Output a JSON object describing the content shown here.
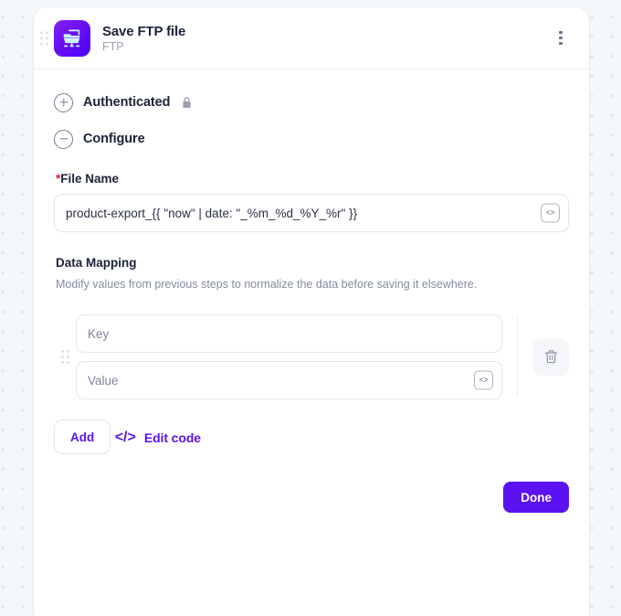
{
  "card": {
    "title": "Save FTP file",
    "subtitle": "FTP",
    "app_icon": "ftp-folder-icon",
    "drag_handle_icon": "drag-handle-icon",
    "menu_icon": "kebab-menu-icon",
    "icon_gradient_from": "#8322f5",
    "icon_gradient_to": "#4b04ff"
  },
  "sections": {
    "authenticated": {
      "label": "Authenticated",
      "toggle_icon": "plus-circle-icon",
      "lock_icon": "lock-icon",
      "expanded": false
    },
    "configure": {
      "label": "Configure",
      "toggle_icon": "minus-circle-icon",
      "expanded": true
    }
  },
  "configure": {
    "file_name": {
      "label": "File Name",
      "required_marker": "*",
      "value": "product-export_{{ \"now\" | date: \"_%m_%d_%Y_%r\" }}",
      "code_toggle_icon": "code-brackets-icon",
      "code_toggle_glyph": "<>"
    },
    "data_mapping": {
      "title": "Data Mapping",
      "description": "Modify values from previous steps to normalize the data before saving it elsewhere.",
      "rows": [
        {
          "key_placeholder": "Key",
          "key_value": "",
          "value_placeholder": "Value",
          "value_value": "",
          "code_toggle_glyph": "<>",
          "delete_icon": "trash-icon",
          "drag_icon": "drag-handle-icon"
        }
      ],
      "add_label": "Add"
    },
    "edit_code": {
      "label": "Edit code",
      "glyph": "</>",
      "color": "#5b12f0"
    }
  },
  "footer": {
    "done_label": "Done",
    "done_color": "#5b12f0"
  }
}
